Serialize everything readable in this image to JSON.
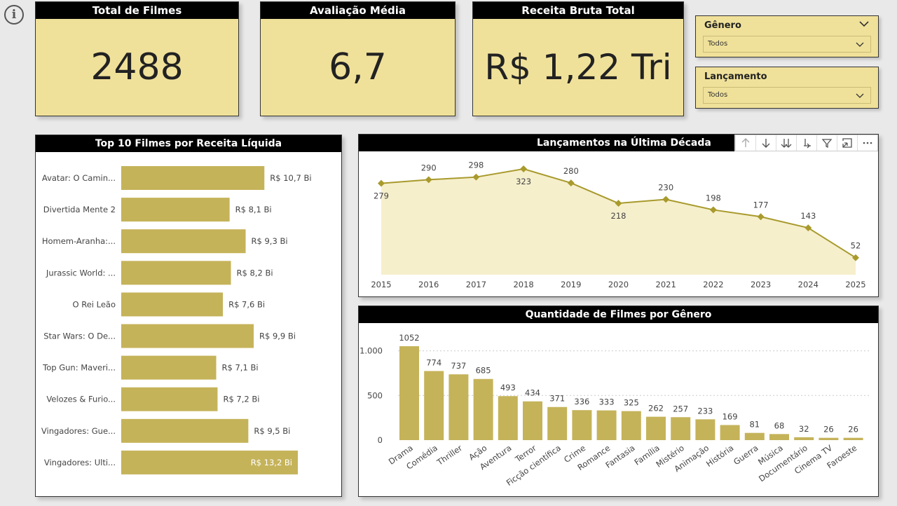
{
  "kpis": [
    {
      "title": "Total de Filmes",
      "value": "2488"
    },
    {
      "title": "Avaliação Média",
      "value": "6,7"
    },
    {
      "title": "Receita Bruta Total",
      "value": "R$ 1,22 Tri"
    }
  ],
  "slicers": [
    {
      "title": "Gênero",
      "selected": "Todos"
    },
    {
      "title": "Lançamento",
      "selected": "Todos"
    }
  ],
  "colors": {
    "accent": "#f0e19a",
    "bar": "#c5b35a",
    "line": "#a89a2c",
    "area": "#f6efcc",
    "header": "#000000"
  },
  "chart_data": [
    {
      "type": "bar",
      "orientation": "horizontal",
      "title": "Top 10 Filmes por Receita Líquida",
      "categories": [
        "Avatar: O Camin...",
        "Divertida Mente 2",
        "Homem-Aranha:...",
        "Jurassic World: ...",
        "O Rei Leão",
        "Star Wars: O De...",
        "Top Gun: Maveri...",
        "Velozes & Furio...",
        "Vingadores: Gue...",
        "Vingadores: Ulti..."
      ],
      "values": [
        10.7,
        8.1,
        9.3,
        8.2,
        7.6,
        9.9,
        7.1,
        7.2,
        9.5,
        13.2
      ],
      "labels": [
        "R$ 10,7 Bi",
        "R$ 8,1 Bi",
        "R$ 9,3 Bi",
        "R$ 8,2 Bi",
        "R$ 7,6 Bi",
        "R$ 9,9 Bi",
        "R$ 7,1 Bi",
        "R$ 7,2 Bi",
        "R$ 9,5 Bi",
        "R$ 13,2 Bi"
      ],
      "xlim": [
        0,
        13.2
      ]
    },
    {
      "type": "area",
      "title": "Lançamentos na Última Década",
      "x": [
        "2015",
        "2016",
        "2017",
        "2018",
        "2019",
        "2020",
        "2021",
        "2022",
        "2023",
        "2024",
        "2025"
      ],
      "values": [
        279,
        290,
        298,
        323,
        280,
        218,
        230,
        198,
        177,
        143,
        52
      ],
      "ylim": [
        0,
        323
      ]
    },
    {
      "type": "bar",
      "title": "Quantidade de Filmes por Gênero",
      "categories": [
        "Drama",
        "Comédia",
        "Thriller",
        "Ação",
        "Aventura",
        "Terror",
        "Ficção científica",
        "Crime",
        "Romance",
        "Fantasia",
        "Família",
        "Mistério",
        "Animação",
        "História",
        "Guerra",
        "Música",
        "Documentário",
        "Cinema TV",
        "Faroeste"
      ],
      "values": [
        1052,
        774,
        737,
        685,
        493,
        434,
        371,
        336,
        333,
        325,
        262,
        257,
        233,
        169,
        81,
        68,
        32,
        26,
        26
      ],
      "yticks": [
        "0",
        "500",
        "1.000"
      ],
      "ylim": [
        0,
        1052
      ]
    }
  ]
}
